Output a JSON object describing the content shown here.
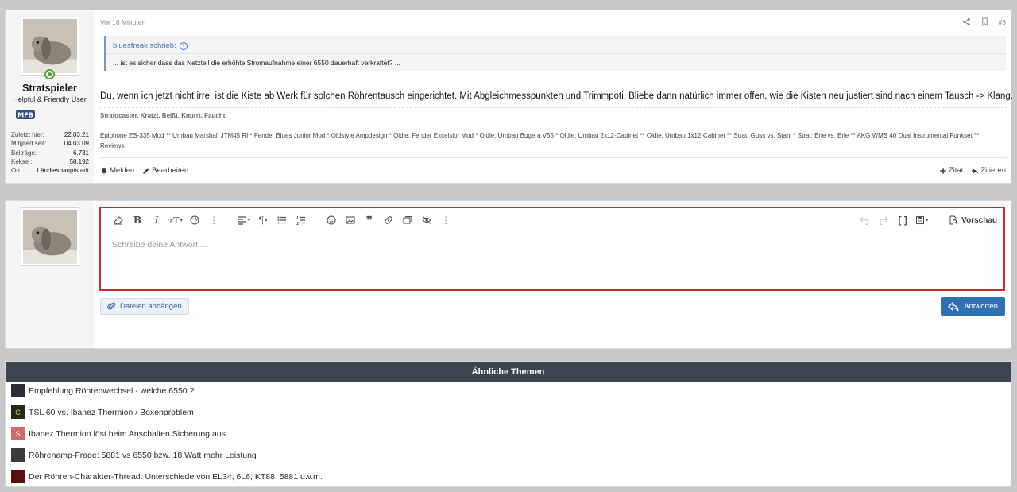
{
  "post": {
    "time": "Vor 16 Minuten",
    "number": "#3",
    "user": {
      "name": "Stratspieler",
      "title": "Helpful & Friendly User",
      "stats": [
        {
          "k": "Zuletzt hier:",
          "v": "22.03.21"
        },
        {
          "k": "Mitglied seit:",
          "v": "04.03.09"
        },
        {
          "k": "Beiträge:",
          "v": "6.731"
        },
        {
          "k": "Kekse :",
          "v": "58.192"
        },
        {
          "k": "Ort:",
          "v": "Ländleshauptstadt"
        }
      ]
    },
    "quote": {
      "author": "bluesfreak schrieb:",
      "text": "... ist es sicher dass das Netzteil die erhöhte Stromaufnahme einer 6550 dauerhaft verkraftet? ..."
    },
    "body": "Du, wenn ich jetzt nicht irre, ist die Kiste ab Werk für solchen Röhrentausch eingerichtet. Mit Abgleichmesspunkten und Trimmpoti. Bliebe dann natürlich immer offen, wie die Kisten neu justiert sind nach einem Tausch -> Klang.",
    "signature_motto": "Stratocaster. Kratzt. Beißt. Knurrt. Faucht.",
    "signature_gear": "Epiphone ES-335 Mod ** Umbau Marshall JTM45 RI * Fender Blues Junior Mod * Oldstyle Ampdesign * Oldie: Fender Excelsior Mod * Oldie: Umbau Bugera V55 * Oldie: Umbau 2x12-Cabinet ** Oldie: Umbau 1x12-Cabinet ** Strat: Guss vs. Stahl * Strat: Erle vs. Erle ** AKG WMS 40 Dual Instrumental Funkset ** Reviews",
    "actions": {
      "report": "Melden",
      "edit": "Bearbeiten",
      "quote": "Zitat",
      "reply": "Zitieren"
    }
  },
  "editor": {
    "placeholder": "Schreibe deine Antwort....",
    "preview_label": "Vorschau",
    "attach_label": "Dateien anhängen",
    "submit_label": "Antworten"
  },
  "similar": {
    "title": "Ähnliche Themen",
    "threads": [
      {
        "title": "Empfehlung Röhrenwechsel - welche 6550 ?",
        "icon_color": "#2a2f3a",
        "icon_text": ""
      },
      {
        "title": "TSL 60 vs. Ibanez Thermion / Boxenproblem",
        "icon_color": "#1f2a12",
        "icon_text": "C"
      },
      {
        "title": "Ibanez Thermion löst beim Anschalten Sicherung aus",
        "icon_color": "#d36a6a",
        "icon_text": "S"
      },
      {
        "title": "Röhrenamp-Frage: 5881 vs 6550 bzw. 18 Watt mehr Leistung",
        "icon_color": "#3b3b3b",
        "icon_text": ""
      },
      {
        "title": "Der Röhren-Charakter-Thread: Unterschiede von EL34, 6L6, KT88, 5881 u.v.m.",
        "icon_color": "#5a1010",
        "icon_text": ""
      }
    ]
  },
  "colors": {
    "accent": "#3070b4",
    "editor_border": "#cc2a2a",
    "header_dark": "#3a4650",
    "online": "#57a142"
  }
}
